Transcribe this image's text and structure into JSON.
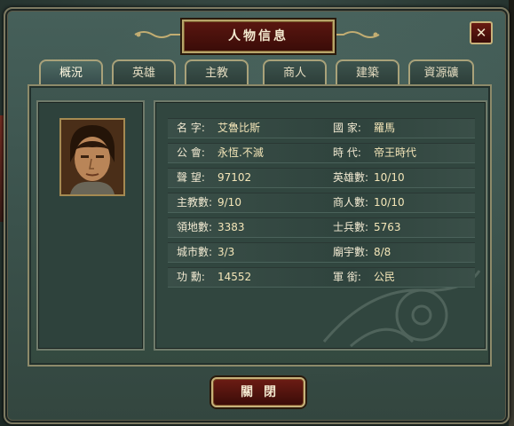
{
  "window": {
    "title": "人物信息",
    "close_symbol": "✕"
  },
  "tabs": [
    {
      "label": "概況",
      "active": true
    },
    {
      "label": "英雄",
      "active": false
    },
    {
      "label": "主教",
      "active": false
    },
    {
      "label": "商人",
      "active": false
    },
    {
      "label": "建築",
      "active": false
    },
    {
      "label": "資源礦",
      "active": false
    }
  ],
  "rows": [
    {
      "l1": "名  字:",
      "v1": "艾魯比斯",
      "l2": "國  家:",
      "v2": "羅馬"
    },
    {
      "l1": "公  會:",
      "v1": "永恆.不滅",
      "l2": "時  代:",
      "v2": "帝王時代"
    },
    {
      "l1": "聲  望:",
      "v1": "97102",
      "l2": "英雄數:",
      "v2": "10/10"
    },
    {
      "l1": "主教數:",
      "v1": "9/10",
      "l2": "商人數:",
      "v2": "10/10"
    },
    {
      "l1": "領地數:",
      "v1": "3383",
      "l2": "士兵數:",
      "v2": "5763"
    },
    {
      "l1": "城市數:",
      "v1": "3/3",
      "l2": "廟宇數:",
      "v2": "8/8"
    },
    {
      "l1": "功  勳:",
      "v1": "14552",
      "l2": "軍  銜:",
      "v2": "公民"
    }
  ],
  "footer": {
    "close_label": "關閉"
  },
  "colors": {
    "accent": "#5a1610",
    "frame_gold": "#b8a56a",
    "panel_teal": "#3f5650"
  },
  "icons": {
    "close": "close-icon",
    "portrait": "character-portrait"
  }
}
